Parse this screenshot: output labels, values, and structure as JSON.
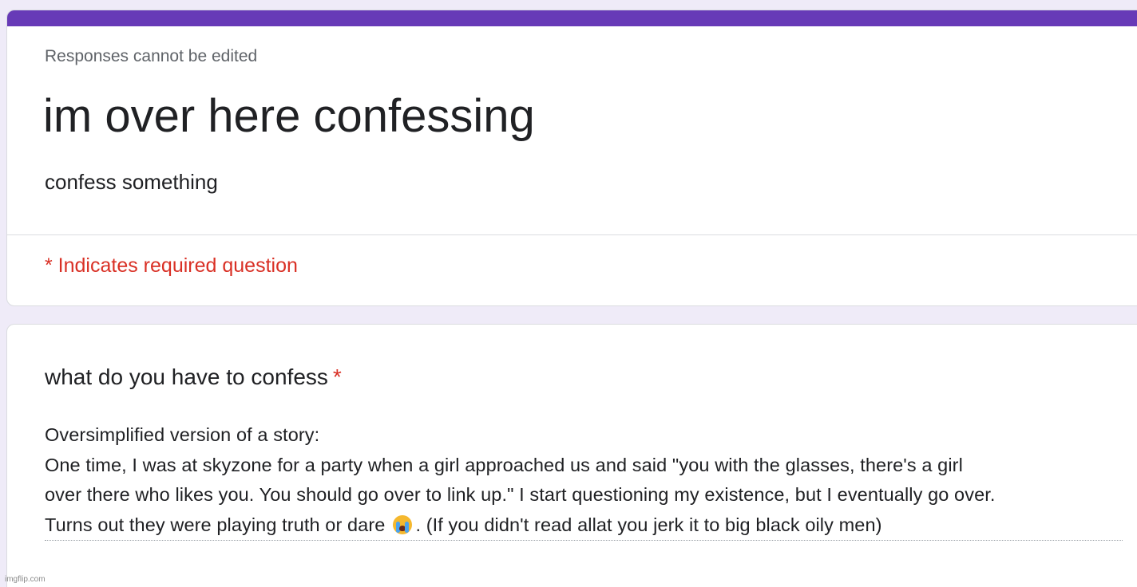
{
  "theme": {
    "accent": "#673ab7",
    "background": "#efebf8",
    "required": "#d93025"
  },
  "form_header": {
    "notice": "Responses cannot be edited",
    "title": "im over here confessing",
    "description": "confess something",
    "required_note": "* Indicates required question"
  },
  "question": {
    "title": "what do you have to confess",
    "required_marker": "*",
    "answer_lines": [
      "Oversimplified version of a story:",
      "One time, I was at skyzone for a party when a girl approached us and said \"you with the glasses, there's a girl",
      "over there who likes you. You should go over to link up.\" I start questioning my existence, but I eventually go over.",
      "Turns out they were playing truth or dare"
    ],
    "answer_emoji": "loudly-crying-face-icon",
    "answer_tail": ". (If you didn't read allat you jerk it to big black oily men)"
  },
  "watermark": "imgflip.com"
}
